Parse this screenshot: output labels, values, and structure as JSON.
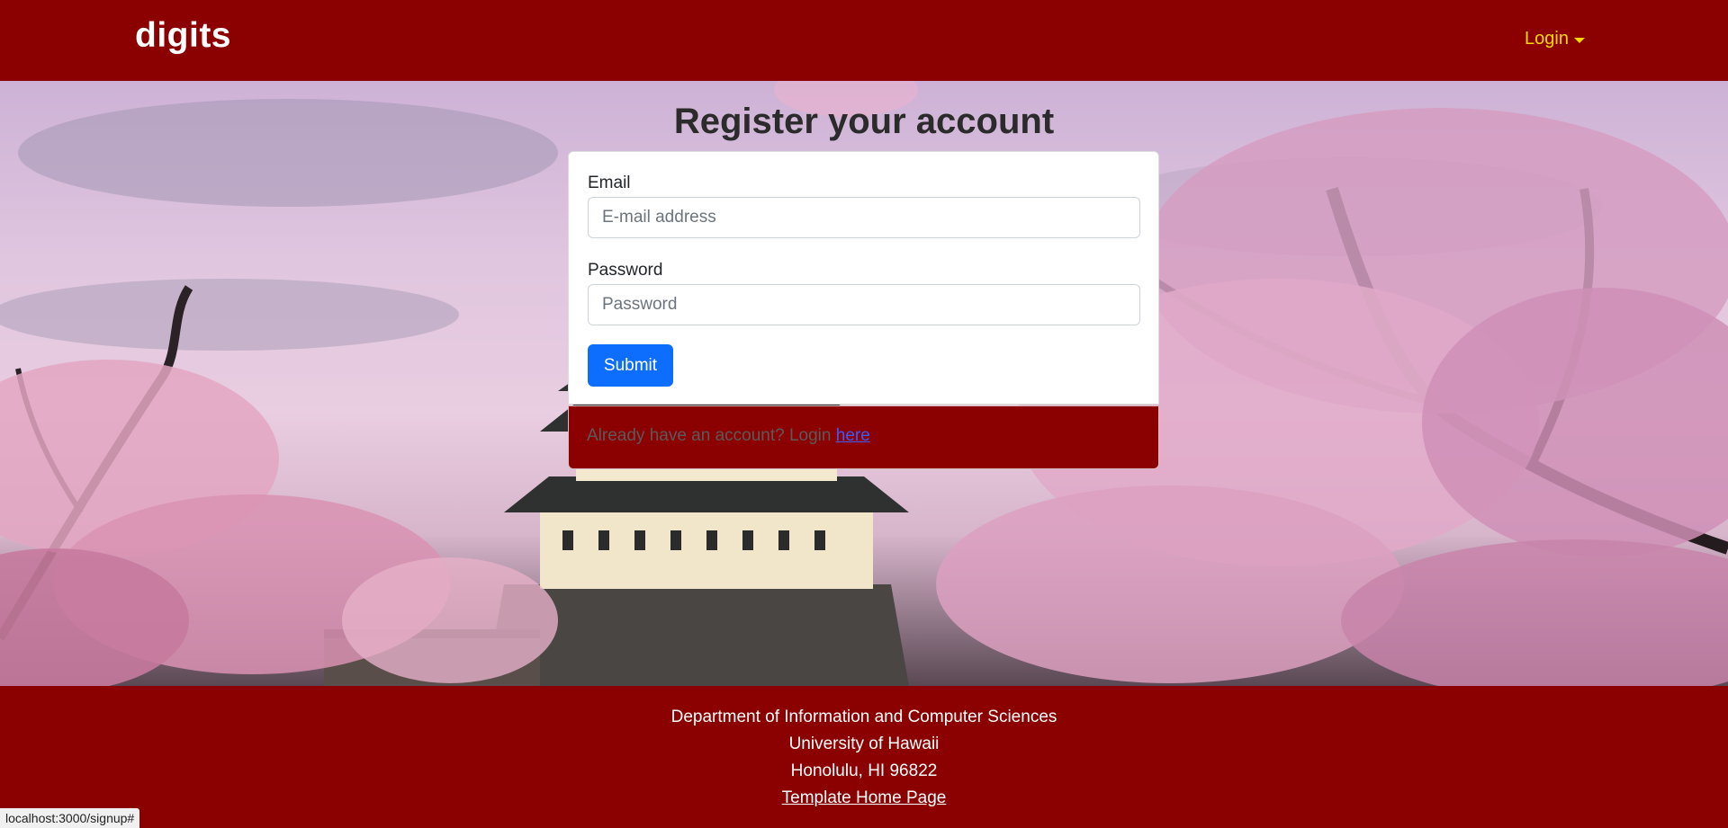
{
  "navbar": {
    "brand": "digits",
    "login_label": "Login",
    "brand_color": "#8b0000",
    "accent_color": "#ffd800"
  },
  "hero": {
    "background": "cherry blossom trees and Japanese castle photo"
  },
  "register": {
    "title": "Register your account",
    "email_label": "Email",
    "email_placeholder": "E-mail address",
    "email_value": "",
    "password_label": "Password",
    "password_placeholder": "Password",
    "password_value": "",
    "submit_label": "Submit",
    "already_text": "Already have an account? Login",
    "here_link": "here"
  },
  "footer": {
    "department": "Department of Information and Computer Sciences",
    "university": "University of Hawaii",
    "location": "Honolulu, HI 96822",
    "template_link": "Template Home Page"
  },
  "status_bar": {
    "url": "localhost:3000/signup#"
  }
}
